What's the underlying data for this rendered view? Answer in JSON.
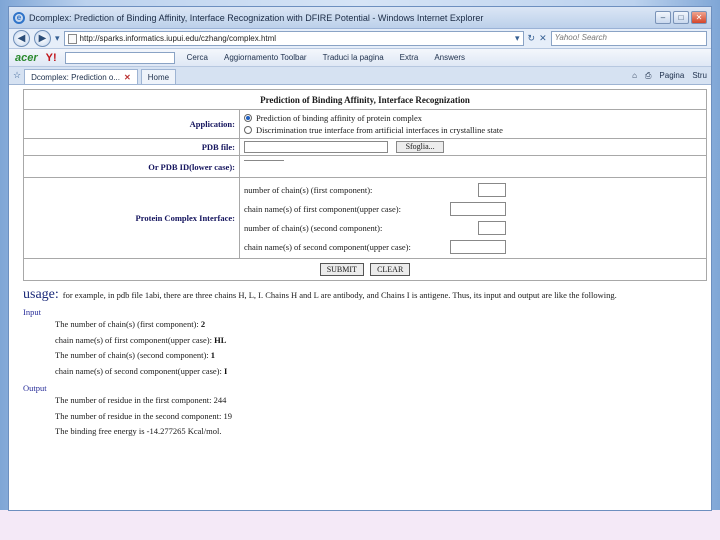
{
  "window": {
    "title": "Dcomplex: Prediction of Binding Affinity, Interface Recognization with DFIRE Potential - Windows Internet Explorer",
    "url": "http://sparks.informatics.iupui.edu/czhang/complex.html",
    "search_placeholder": "Yahoo! Search"
  },
  "toolbar": {
    "acer": "acer",
    "yahoo": "Y!",
    "cerca": "Cerca",
    "aggiornamento": "Aggiornamento Toolbar",
    "traduci": "Traduci la pagina",
    "extra": "Extra",
    "answers": "Answers",
    "pagina": "Pagina",
    "strumenti": "Stru"
  },
  "tabs": [
    {
      "label": "Dcomplex: Prediction o..."
    },
    {
      "label": "Home"
    }
  ],
  "form": {
    "title": "Prediction of Binding Affinity, Interface Recognization",
    "application_label": "Application:",
    "option_1": "Prediction of binding affinity of protein complex",
    "option_2": "Discrimination true interface from artificial interfaces in crystalline state",
    "pdb_file_label": "PDB file:",
    "browse_label": "Sfoglia...",
    "pdb_id_label": "Or PDB ID(lower case):",
    "interface_label": "Protein Complex Interface:",
    "fields": [
      "number of chain(s) (first component):",
      "chain name(s) of first component(upper case):",
      "number of chain(s) (second component):",
      "chain name(s) of second component(upper case):"
    ],
    "submit_label": "SUBMIT",
    "clear_label": "CLEAR"
  },
  "usage": {
    "heading": "usage:",
    "text": "for example, in pdb file 1abi, there are three chains H, L, I. Chains H and L are antibody, and Chains I is antigene. Thus, its input and output are like the following.",
    "input_label": "Input",
    "input_lines": [
      {
        "text": "The number of chain(s) (first component):",
        "value": "2"
      },
      {
        "text": "chain name(s) of first component(upper case):",
        "value": "HL"
      },
      {
        "text": "The number of chain(s) (second component):",
        "value": "1"
      },
      {
        "text": "chain name(s) of second component(upper case):",
        "value": "I"
      }
    ],
    "output_label": "Output",
    "output_lines": [
      "The number of residue in the first component: 244",
      "The number of residue in the second component: 19",
      "The binding free energy is -14.277265 Kcal/mol."
    ]
  }
}
